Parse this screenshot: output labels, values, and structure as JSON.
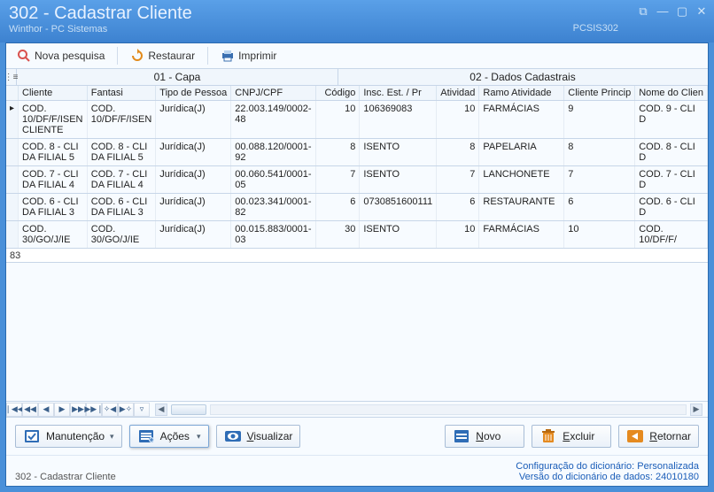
{
  "window": {
    "title": "302 - Cadastrar Cliente",
    "subtitle": "Winthor - PC Sistemas",
    "syscode": "PCSIS302"
  },
  "toolbar": {
    "nova_pesquisa": "Nova pesquisa",
    "restaurar": "Restaurar",
    "imprimir": "Imprimir"
  },
  "categories": {
    "capa": "01 - Capa",
    "dados": "02 - Dados Cadastrais"
  },
  "columns": {
    "cliente": "Cliente",
    "fantasia": "Fantasi",
    "tipo_pessoa": "Tipo de Pessoa",
    "cnpj_cpf": "CNPJ/CPF",
    "codigo": "Código",
    "insc_est": "Insc. Est. / Pr",
    "atividade": "Atividad",
    "ramo": "Ramo Atividade",
    "cliente_princ": "Cliente Princip",
    "nome_cliente": "Nome do Clien"
  },
  "rows": [
    {
      "cliente": "COD. 10/DF/F/ISEN CLIENTE",
      "fantasia": "COD. 10/DF/F/ISEN",
      "tipo": "Jurídica(J)",
      "cnpj": "22.003.149/0002-48",
      "codigo": "10",
      "insc": "106369083",
      "atividade": "10",
      "ramo": "FARMÁCIAS",
      "princ": "9",
      "nome": "COD. 9 - CLI D"
    },
    {
      "cliente": "COD. 8 - CLI DA FILIAL 5",
      "fantasia": "COD. 8 - CLI DA FILIAL 5",
      "tipo": "Jurídica(J)",
      "cnpj": "00.088.120/0001-92",
      "codigo": "8",
      "insc": "ISENTO",
      "atividade": "8",
      "ramo": "PAPELARIA",
      "princ": "8",
      "nome": "COD. 8 - CLI D"
    },
    {
      "cliente": "COD. 7 - CLI DA FILIAL 4",
      "fantasia": "COD. 7 - CLI DA FILIAL 4",
      "tipo": "Jurídica(J)",
      "cnpj": "00.060.541/0001-05",
      "codigo": "7",
      "insc": "ISENTO",
      "atividade": "7",
      "ramo": "LANCHONETE",
      "princ": "7",
      "nome": "COD. 7 - CLI D"
    },
    {
      "cliente": "COD. 6 - CLI DA FILIAL 3",
      "fantasia": "COD. 6 - CLI DA FILIAL 3",
      "tipo": "Jurídica(J)",
      "cnpj": "00.023.341/0001-82",
      "codigo": "6",
      "insc": "0730851600111",
      "atividade": "6",
      "ramo": "RESTAURANTE",
      "princ": "6",
      "nome": "COD. 6 - CLI D"
    },
    {
      "cliente": "COD. 30/GO/J/IE",
      "fantasia": "COD. 30/GO/J/IE",
      "tipo": "Jurídica(J)",
      "cnpj": "00.015.883/0001-03",
      "codigo": "30",
      "insc": "ISENTO",
      "atividade": "10",
      "ramo": "FARMÁCIAS",
      "princ": "10",
      "nome": "COD. 10/DF/F/"
    }
  ],
  "record_count": "83",
  "buttons": {
    "manutencao": "Manutenção",
    "acoes": "Ações",
    "visualizar": "Visualizar",
    "novo": "Novo",
    "excluir": "Excluir",
    "retornar": "Retornar"
  },
  "status": {
    "left": "302 - Cadastrar Cliente",
    "config_label": "Configuração do dicionário:",
    "config_value": "Personalizada",
    "versao_label": "Versão do dicionário de dados:",
    "versao_value": "24010180"
  }
}
